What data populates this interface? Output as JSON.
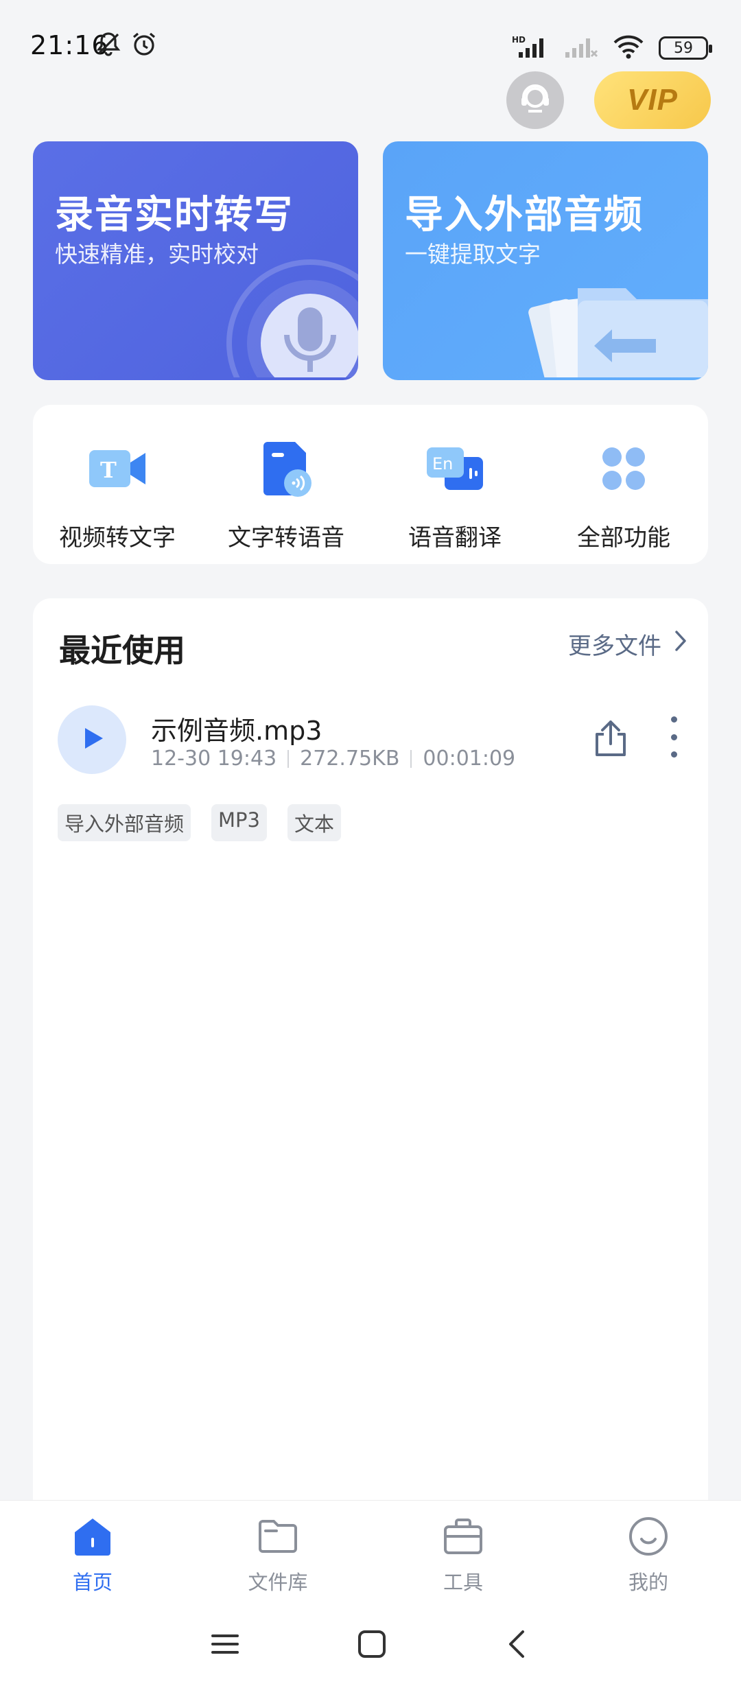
{
  "status_bar": {
    "time": "21:16",
    "battery": "59",
    "network": "HD"
  },
  "header": {
    "vip_label": "VIP"
  },
  "hero_cards": [
    {
      "title": "录音实时转写",
      "subtitle": "快速精准，实时校对"
    },
    {
      "title": "导入外部音频",
      "subtitle": "一键提取文字"
    }
  ],
  "tools": [
    {
      "label": "视频转文字",
      "icon": "video-to-text-icon"
    },
    {
      "label": "文字转语音",
      "icon": "text-to-speech-icon"
    },
    {
      "label": "语音翻译",
      "icon": "voice-translate-icon"
    },
    {
      "label": "全部功能",
      "icon": "all-features-icon"
    }
  ],
  "recent": {
    "title": "最近使用",
    "more_label": "更多文件",
    "files": [
      {
        "name": "示例音频.mp3",
        "date": "12-30 19:43",
        "size": "272.75KB",
        "duration": "00:01:09",
        "tags": [
          "导入外部音频",
          "MP3",
          "文本"
        ]
      }
    ]
  },
  "bottom_nav": [
    {
      "label": "首页",
      "active": true
    },
    {
      "label": "文件库",
      "active": false
    },
    {
      "label": "工具",
      "active": false
    },
    {
      "label": "我的",
      "active": false
    }
  ],
  "colors": {
    "accent": "#2f6ef0",
    "record_card": "#5568e2",
    "import_card": "#5ea8fa",
    "vip_gold": "#f7c84b"
  }
}
